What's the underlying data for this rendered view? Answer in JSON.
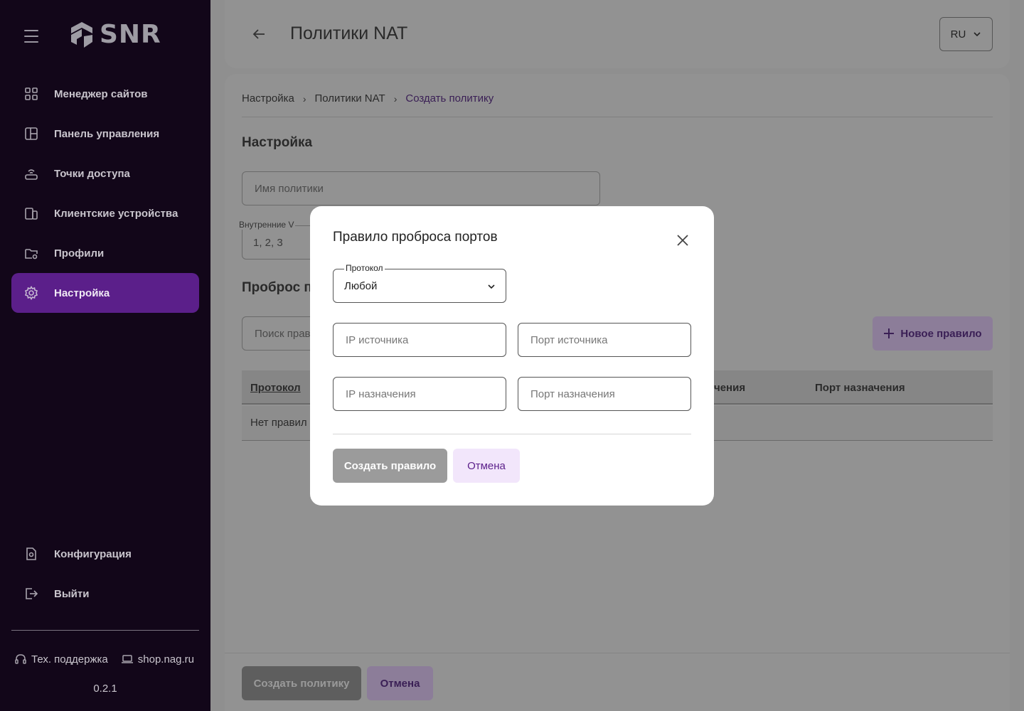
{
  "sidebar": {
    "logo_text": "SNR",
    "items": [
      {
        "label": "Менеджер сайтов",
        "icon": "grid-icon"
      },
      {
        "label": "Панель управления",
        "icon": "dashboard-icon"
      },
      {
        "label": "Точки доступа",
        "icon": "router-icon"
      },
      {
        "label": "Клиентские устройства",
        "icon": "devices-icon"
      },
      {
        "label": "Профили",
        "icon": "folder-gear-icon"
      },
      {
        "label": "Настройка",
        "icon": "gear-icon",
        "active": true
      }
    ],
    "bottom_items": [
      {
        "label": "Конфигурация",
        "icon": "config-file-icon"
      },
      {
        "label": "Выйти",
        "icon": "logout-icon"
      }
    ],
    "support_label": "Тех. поддержка",
    "shop_label": "shop.nag.ru",
    "version": "0.2.1"
  },
  "header": {
    "title": "Политики NAT",
    "lang": "RU"
  },
  "breadcrumb": [
    "Настройка",
    "Политики NAT",
    "Создать политику"
  ],
  "main": {
    "section_title": "Настройка",
    "policy_name_placeholder": "Имя политики",
    "vlan_label": "Внутренние V",
    "vlan_value": "1, 2, 3",
    "section2_title": "Проброс п",
    "search_placeholder": "Поиск прав",
    "new_rule_label": "Новое правило",
    "table": {
      "headers": [
        "Протокол",
        "чения",
        "Порт назначения"
      ],
      "empty_text": "Нет правил"
    }
  },
  "footer": {
    "create_label": "Создать политику",
    "cancel_label": "Отмена"
  },
  "modal": {
    "title": "Правило проброса портов",
    "protocol_label": "Протокол",
    "protocol_value": "Любой",
    "src_ip_placeholder": "IP источника",
    "src_port_placeholder": "Порт источника",
    "dst_ip_placeholder": "IP назначения",
    "dst_port_placeholder": "Порт назначения",
    "create_label": "Создать правило",
    "cancel_label": "Отмена"
  },
  "colors": {
    "sidebar_bg": "#120619",
    "accent": "#5b1f8a",
    "accent_light": "#f2e6fb"
  }
}
